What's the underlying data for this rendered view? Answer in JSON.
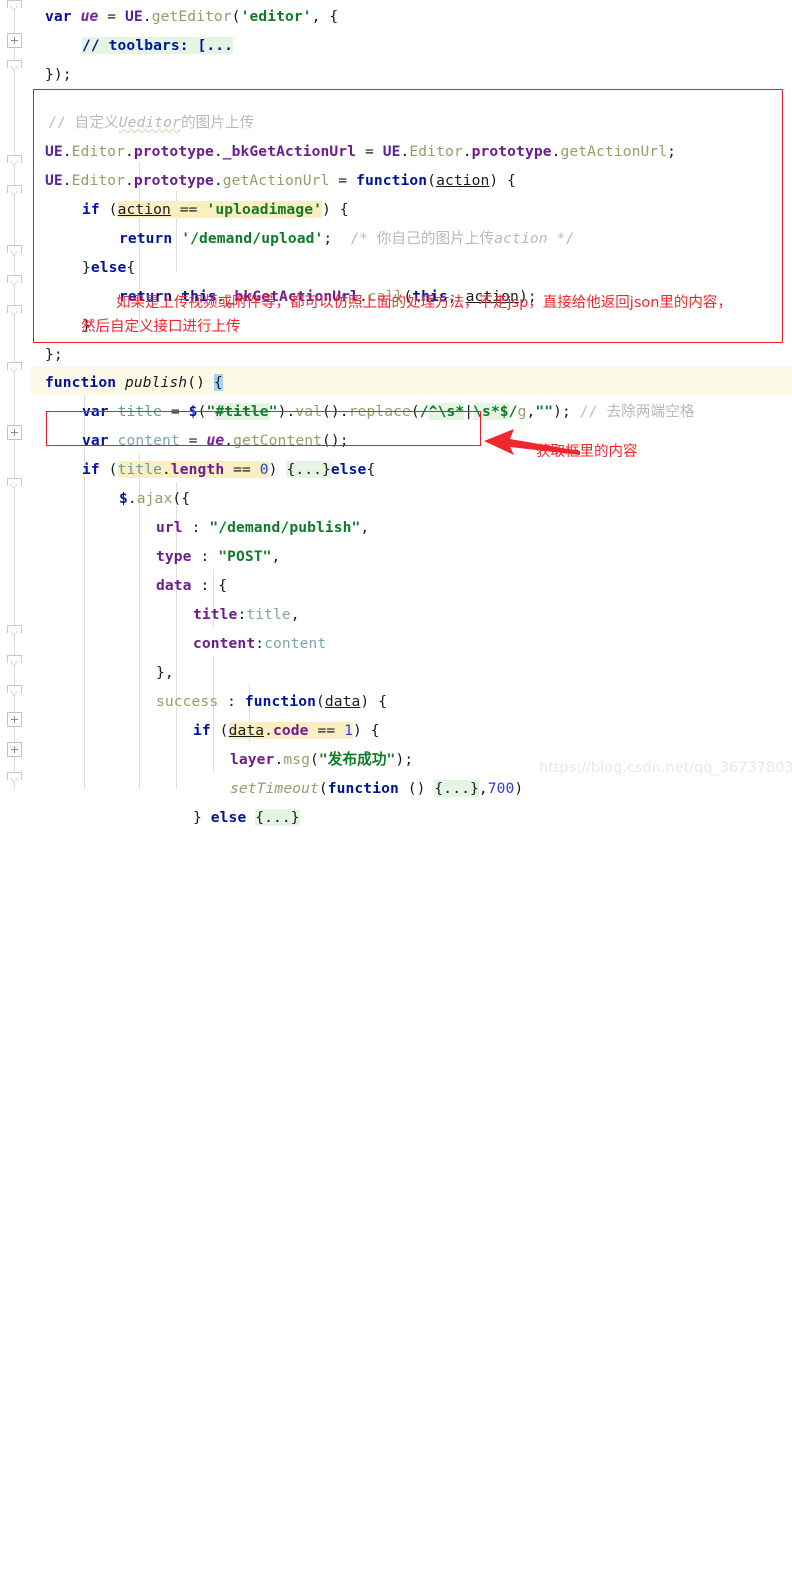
{
  "editor": {
    "language": "javascript",
    "font_size_px": 14.6,
    "line_height_px": 29,
    "background": "#ffffff",
    "highlight_row_color": "#fdf9e7",
    "colors": {
      "keyword": "#00139e",
      "class": "#5c1f9e",
      "property": "#6e1b8f",
      "method": "#9a9a6a",
      "string": "#0f7b26",
      "comment": "#b9b9b9",
      "number": "#2b3fd6",
      "identifier": "#5f9ea0",
      "annotation_red": "#f0272d",
      "box_red": "#ec1c24",
      "search_highlight": "#faeec2",
      "fold_highlight": "#e5f5e3",
      "brace_match": "#a5d2f5",
      "indent_guide": "#dedede",
      "watermark": "#e8e8e8"
    }
  },
  "lines": [
    {
      "n": 1,
      "indent": 0,
      "text": "var ue = UE.getEditor('editor', {"
    },
    {
      "n": 2,
      "indent": 1,
      "text": "// toolbars: [..."
    },
    {
      "n": 3,
      "indent": 0,
      "text": "});"
    },
    {
      "n": 4,
      "indent": 0,
      "text": ""
    },
    {
      "n": 5,
      "indent": 0,
      "text": "// 自定义Ueditor的图片上传"
    },
    {
      "n": 6,
      "indent": 0,
      "text": "UE.Editor.prototype._bkGetActionUrl = UE.Editor.prototype.getActionUrl;"
    },
    {
      "n": 7,
      "indent": 0,
      "text": "UE.Editor.prototype.getActionUrl = function(action) {"
    },
    {
      "n": 8,
      "indent": 1,
      "text": "if (action == 'uploadimage') {"
    },
    {
      "n": 9,
      "indent": 2,
      "text": "return '/demand/upload'; /* 你自己的图片上传action */"
    },
    {
      "n": 10,
      "indent": 1,
      "text": "}else{"
    },
    {
      "n": 11,
      "indent": 2,
      "text": "return this._bkGetActionUrl.call(this, action);"
    },
    {
      "n": 12,
      "indent": 1,
      "text": "}"
    },
    {
      "n": 13,
      "indent": 0,
      "text": "};"
    },
    {
      "n": 14,
      "indent": 0,
      "text": ""
    },
    {
      "n": 15,
      "indent": 0,
      "text": "function publish() {"
    },
    {
      "n": 16,
      "indent": 1,
      "text": "var title = $(\"#title\").val().replace(/^\\s*|\\s*$/g,\"\"); // 去除两端空格"
    },
    {
      "n": 17,
      "indent": 1,
      "text": "var content = ue.getContent();"
    },
    {
      "n": 18,
      "indent": 1,
      "text": "if (title.length == 0) {...}else{"
    },
    {
      "n": 19,
      "indent": 2,
      "text": "$.ajax({"
    },
    {
      "n": 20,
      "indent": 3,
      "text": "url : \"/demand/publish\","
    },
    {
      "n": 21,
      "indent": 3,
      "text": "type : \"POST\","
    },
    {
      "n": 22,
      "indent": 3,
      "text": "data : {"
    },
    {
      "n": 23,
      "indent": 4,
      "text": "title:title,"
    },
    {
      "n": 24,
      "indent": 4,
      "text": "content:content"
    },
    {
      "n": 25,
      "indent": 3,
      "text": "},"
    },
    {
      "n": 26,
      "indent": 3,
      "text": "success : function(data) {"
    },
    {
      "n": 27,
      "indent": 4,
      "text": "if (data.code == 1) {"
    },
    {
      "n": 28,
      "indent": 5,
      "text": "layer.msg(\"发布成功\");"
    },
    {
      "n": 29,
      "indent": 5,
      "text": "setTimeout(function () {...},700)"
    },
    {
      "n": 30,
      "indent": 4,
      "text": "} else {...}"
    }
  ],
  "annotations": {
    "box1_note_line1": "如果是上传视频或附件等，都可以仿照上面的处理方法，不走jsp，直接给他返回json里的内容，",
    "box1_note_line2": "然后自定义接口进行上传",
    "arrow_note": "获取框里的内容"
  },
  "watermark": {
    "text": "https://blog.csdn.net/qq_36737803"
  },
  "gutter": {
    "fold_minus": "fold-collapse-icon",
    "fold_plus": "fold-expand-icon",
    "fold_end": "fold-end-icon"
  }
}
